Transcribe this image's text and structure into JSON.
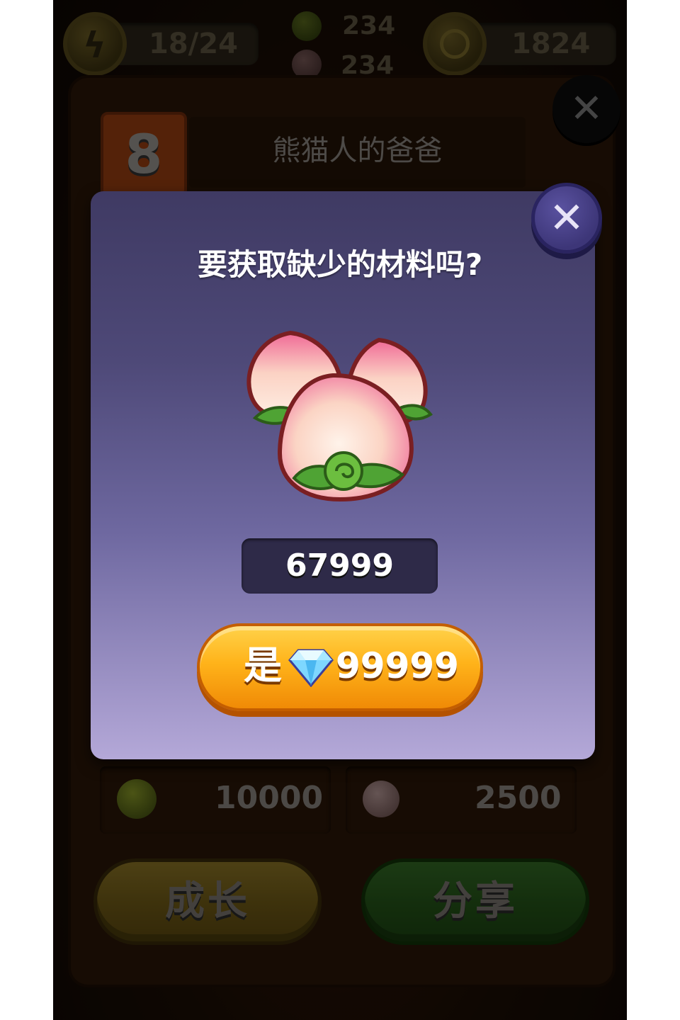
{
  "hud": {
    "energy": "18/24",
    "fruit1_count": "234",
    "fruit2_count": "234",
    "coins": "1824"
  },
  "level": {
    "number": "8",
    "name": "熊猫人的爸爸"
  },
  "dialog": {
    "title": "要获取缺少的材料吗?",
    "item_icon": "peach-icon",
    "item_count": "67999",
    "confirm_label": "是",
    "confirm_price": "99999",
    "price_icon": "diamond-icon"
  },
  "stats": [
    {
      "icon": "orange-fruit-icon",
      "value": "10000"
    },
    {
      "icon": "peach-icon",
      "value": "2500"
    }
  ],
  "buttons": {
    "grow": "成长",
    "share": "分享"
  },
  "colors": {
    "dialog_top": "#3f3a63",
    "dialog_bottom": "#b4a8d8",
    "confirm_button": "#ffb31a",
    "grow_button": "#8c7526",
    "share_button": "#336a25"
  }
}
